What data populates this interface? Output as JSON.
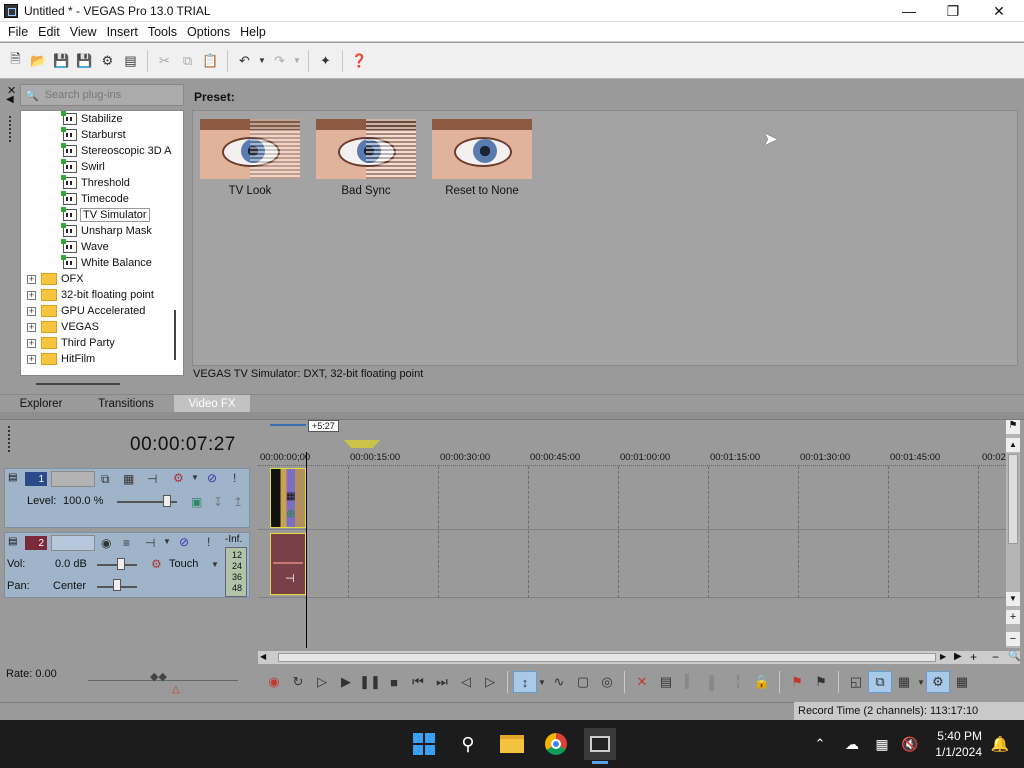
{
  "window": {
    "title": "Untitled * - VEGAS Pro 13.0 TRIAL"
  },
  "menu": [
    "File",
    "Edit",
    "View",
    "Insert",
    "Tools",
    "Options",
    "Help"
  ],
  "search": {
    "placeholder": "Search plug-ins"
  },
  "tree": {
    "plugins": [
      "Stabilize",
      "Starburst",
      "Stereoscopic 3D A",
      "Swirl",
      "Threshold",
      "Timecode",
      "TV Simulator",
      "Unsharp Mask",
      "Wave",
      "White Balance"
    ],
    "selected": "TV Simulator",
    "folders": [
      "OFX",
      "32-bit floating point",
      "GPU Accelerated",
      "VEGAS",
      "Third Party",
      "HitFilm"
    ]
  },
  "presets": {
    "label": "Preset:",
    "items": [
      "TV Look",
      "Bad Sync",
      "Reset to None"
    ],
    "status": "VEGAS TV Simulator: DXT, 32-bit floating point"
  },
  "tabs": [
    "Explorer",
    "Transitions",
    "Video FX"
  ],
  "active_tab": "Video FX",
  "timeline": {
    "timecode": "00:00:07:27",
    "loop_length": "+5:27",
    "ruler": [
      "00:00:00;00",
      "00:00:15:00",
      "00:00:30:00",
      "00:00:45:00",
      "00:01:00:00",
      "00:01:15:00",
      "00:01:30:00",
      "00:01:45:00",
      "00:02"
    ],
    "video_track": {
      "number": "1",
      "level_label": "Level:",
      "level_value": "100.0 %"
    },
    "audio_track": {
      "number": "2",
      "vol_label": "Vol:",
      "vol_value": "0.0 dB",
      "pan_label": "Pan:",
      "pan_value": "Center",
      "mode": "Touch",
      "meter_top": "-Inf.",
      "meter_ticks": [
        "12",
        "24",
        "36",
        "48"
      ]
    },
    "rate": "Rate: 0.00"
  },
  "status": {
    "record_time": "Record Time (2 channels): 113:17:10"
  },
  "taskbar": {
    "time": "5:40 PM",
    "date": "1/1/2024"
  },
  "colors": {
    "track_header": "#9fb4c9",
    "video_num": "#2a4a8a",
    "audio_num": "#7a2a3a",
    "selected_tab": "#c2c2c2"
  }
}
